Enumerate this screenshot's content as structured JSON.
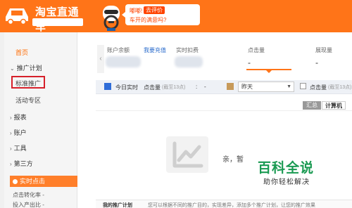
{
  "header": {
    "logo_title": "淘宝直通车",
    "logo_subtitle": "",
    "bubble_hello": "嘟嘟!",
    "rate_button": "去评价",
    "question": "车开的满意吗?",
    "colors": {
      "brand": "#ff7418",
      "accent": "#ff4400"
    }
  },
  "sidebar": {
    "home": "首页",
    "promo_plan": "推广计划",
    "standard_promo": "标准推广",
    "activity_zone": "活动专区",
    "reports": "报表",
    "account": "账户",
    "tools": "工具",
    "third_party": "第三方",
    "realtime": "实时点击",
    "stat_click_rate": "点击转化率 -",
    "stat_roi": "投入产出比 -"
  },
  "account": {
    "balance_label": "账户余额",
    "recharge_link": "我要充值",
    "realtime_deduct": "实时扣费"
  },
  "metrics": {
    "clicks_label": "点击量",
    "clicks_value": "-",
    "impressions_label": "展现量",
    "impressions_value": "-"
  },
  "filter": {
    "today_realtime": "今日实时",
    "clicks": "点击量",
    "hint1": "(截至13点)",
    "colon": ":",
    "dash": "-",
    "clicks2": "点击量",
    "hint2": "(截至13点)",
    "yesterday": "昨天",
    "caret": "▼",
    "colors": {
      "today": "#2f6dd8",
      "yesterday": "#c79a5a"
    }
  },
  "tabs": {
    "summary": "汇总",
    "computer": "计算机"
  },
  "empty_state": {
    "text": "亲，暂",
    "icon": "line-chart-icon"
  },
  "watermark": {
    "title": "百科全说",
    "subtitle": "助你轻松解决"
  },
  "bottom": {
    "item1": "我的推广计划",
    "item2": "您可以根据不同的推广目的，实现差异，添加多个推广计划，让您的推广效果"
  }
}
